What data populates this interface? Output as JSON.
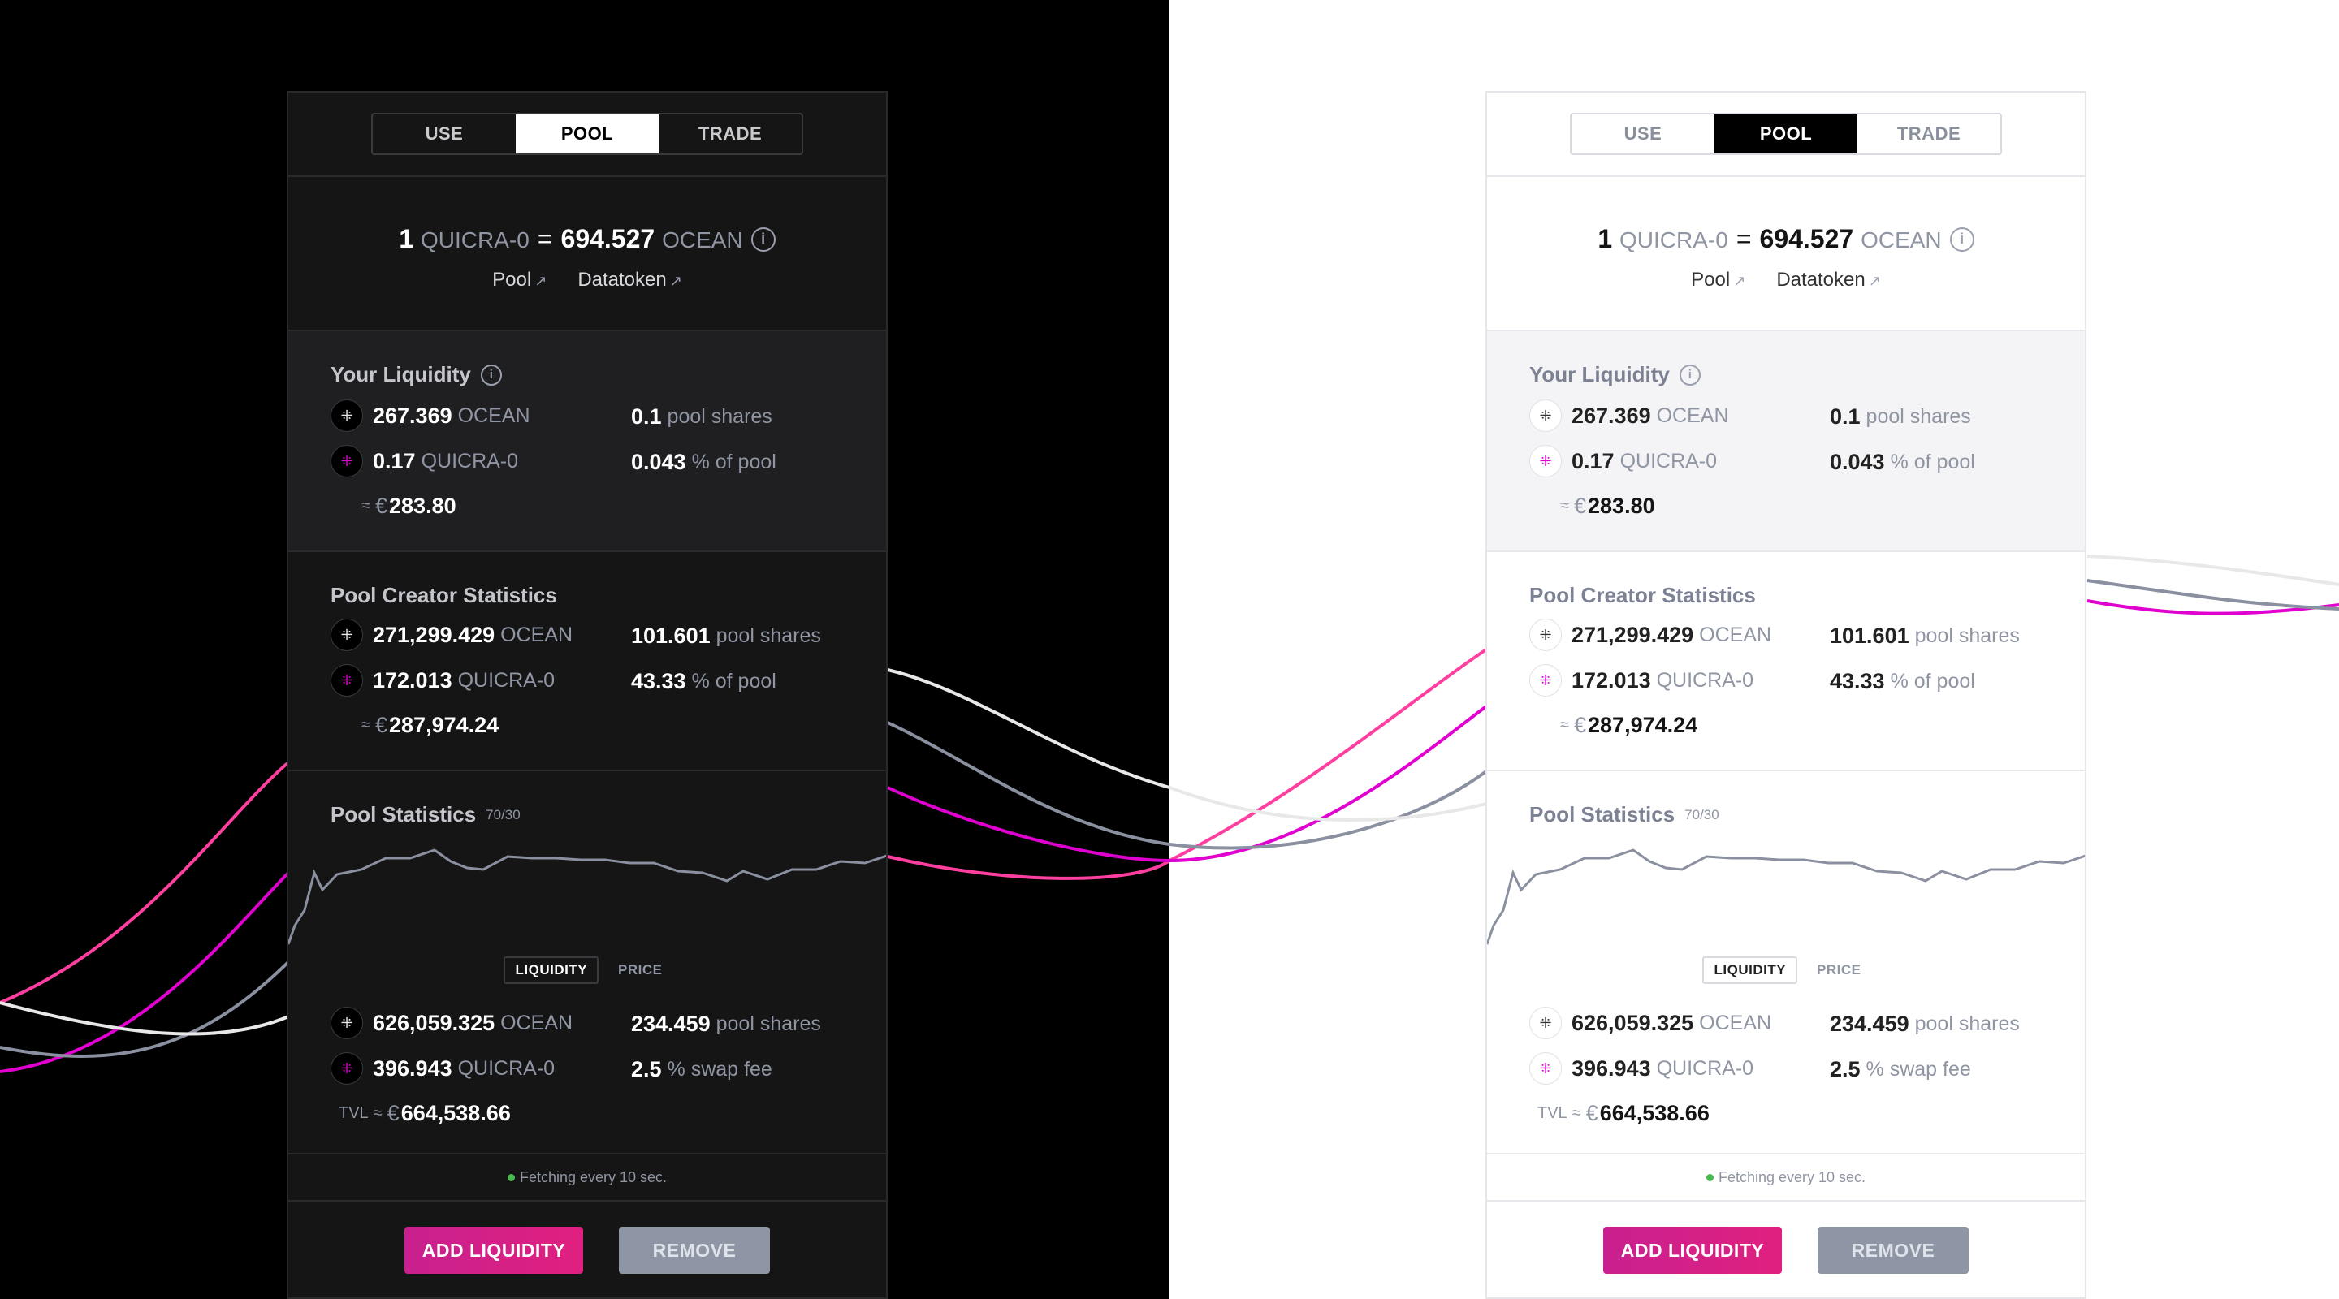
{
  "tabs": [
    "USE",
    "POOL",
    "TRADE"
  ],
  "active_tab": "POOL",
  "price": {
    "base_amount": "1",
    "base_symbol": "QUICRA-0",
    "equals": "=",
    "quote_amount": "694.527",
    "quote_symbol": "OCEAN",
    "link_pool": "Pool",
    "link_datatoken": "Datatoken"
  },
  "your_liquidity": {
    "title": "Your Liquidity",
    "ocean_amount": "267.369",
    "ocean_symbol": "OCEAN",
    "dt_amount": "0.17",
    "dt_symbol": "QUICRA-0",
    "shares": "0.1",
    "shares_label": "pool shares",
    "percent": "0.043",
    "percent_label": "% of pool",
    "fiat_prefix": "≈",
    "fiat_currency": "€",
    "fiat_value": "283.80"
  },
  "creator": {
    "title": "Pool Creator Statistics",
    "ocean_amount": "271,299.429",
    "ocean_symbol": "OCEAN",
    "dt_amount": "172.013",
    "dt_symbol": "QUICRA-0",
    "shares": "101.601",
    "shares_label": "pool shares",
    "percent": "43.33",
    "percent_label": "% of pool",
    "fiat_prefix": "≈",
    "fiat_currency": "€",
    "fiat_value": "287,974.24"
  },
  "stats": {
    "title": "Pool Statistics",
    "weight": "70/30",
    "chart_tab_liquidity": "LIQUIDITY",
    "chart_tab_price": "PRICE",
    "ocean_amount": "626,059.325",
    "ocean_symbol": "OCEAN",
    "dt_amount": "396.943",
    "dt_symbol": "QUICRA-0",
    "shares": "234.459",
    "shares_label": "pool shares",
    "fee": "2.5",
    "fee_label": "% swap fee",
    "tvl_label": "TVL",
    "tvl_prefix": "≈",
    "tvl_currency": "€",
    "tvl_value": "664,538.66"
  },
  "fetch_status": "Fetching every 10 sec.",
  "buttons": {
    "add": "ADD LIQUIDITY",
    "remove": "REMOVE"
  },
  "colors": {
    "accent": "#e0207f",
    "magenta": "#e000cf",
    "status": "#4ab94f",
    "muted": "#8f95a3"
  },
  "icons": {
    "ocean_token": "ocean-token-icon",
    "datatoken": "datatoken-icon",
    "info": "info-icon",
    "external": "external-link-icon"
  }
}
